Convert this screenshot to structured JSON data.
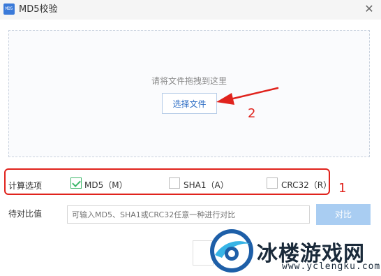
{
  "window": {
    "title": "MD5校验",
    "app_icon_text": "MD5",
    "close_icon": "close-icon"
  },
  "drop_area": {
    "hint": "请将文件拖拽到这里",
    "choose_label": "选择文件"
  },
  "options": {
    "label": "计算选项",
    "items": [
      {
        "label": "MD5（M）",
        "checked": true
      },
      {
        "label": "SHA1（A）",
        "checked": false
      },
      {
        "label": "CRC32（R）",
        "checked": false
      }
    ]
  },
  "compare": {
    "label": "待对比值",
    "placeholder": "可输入MD5、SHA1或CRC32任意一种进行对比",
    "button_label": "对比"
  },
  "annotations": {
    "marker_1": "1",
    "marker_2": "2",
    "color": "#e0231d"
  },
  "watermark": {
    "brand": "冰楼游戏网",
    "url": "www.yclengku.com"
  }
}
